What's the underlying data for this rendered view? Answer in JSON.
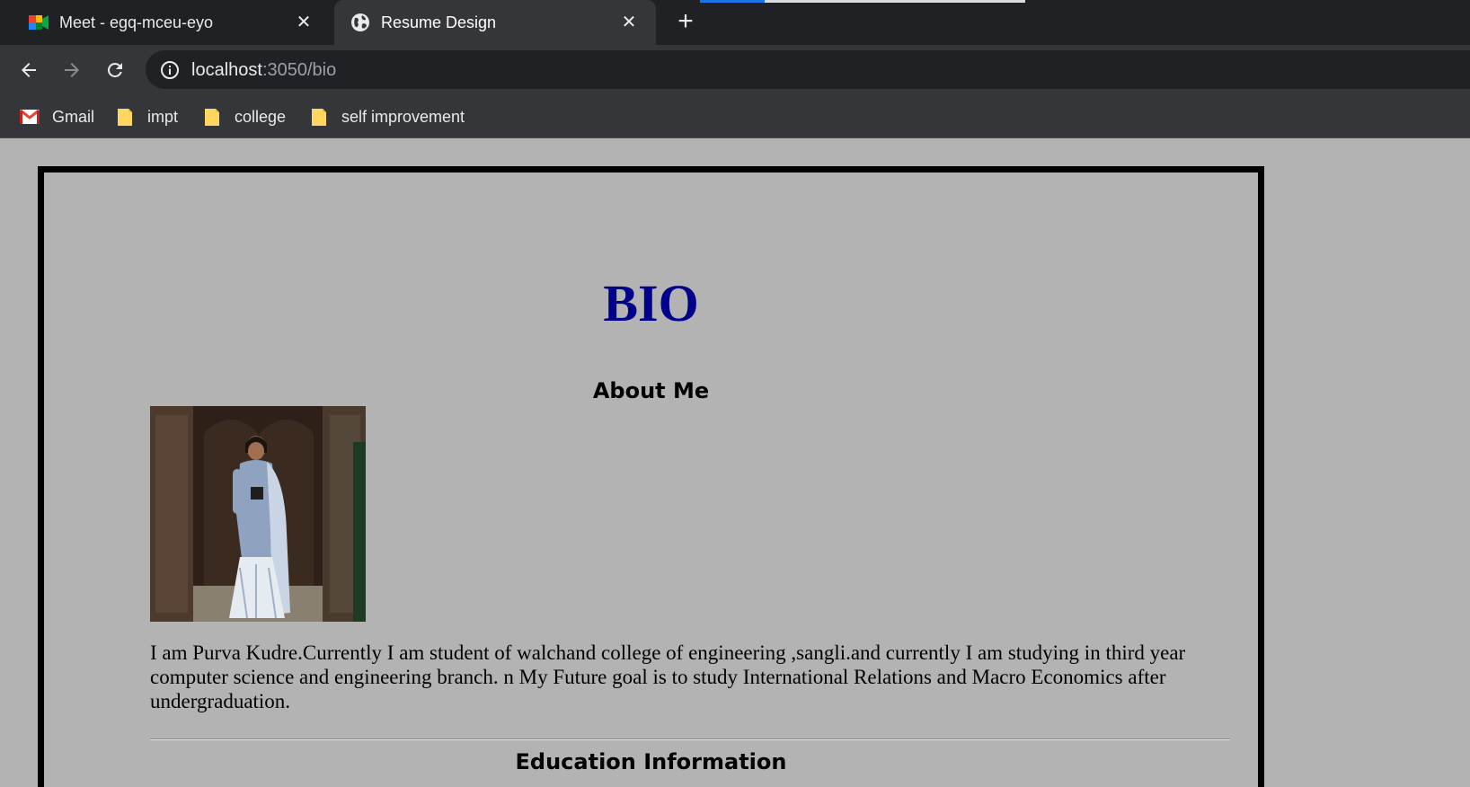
{
  "browser": {
    "tabs": [
      {
        "title": "Meet - egq-mceu-eyo",
        "icon": "google-meet-icon",
        "active": false
      },
      {
        "title": "Resume Design",
        "icon": "globe-icon",
        "active": true
      }
    ],
    "new_tab_symbol": "+",
    "close_symbol": "✕",
    "url": {
      "host": "localhost",
      "path": ":3050/bio"
    },
    "bookmarks": [
      {
        "label": "Gmail",
        "icon": "gmail-icon"
      },
      {
        "label": "impt",
        "icon": "folder-icon"
      },
      {
        "label": "college",
        "icon": "folder-icon"
      },
      {
        "label": "self improvement",
        "icon": "folder-icon"
      }
    ],
    "colors": {
      "tabbar": "#202124",
      "toolbar": "#35363a",
      "accent": "#1a73e8"
    }
  },
  "page": {
    "title": "BIO",
    "about_heading": "About Me",
    "photo": {
      "icon": "profile-photo"
    },
    "bio_text": "I am Purva Kudre.Currently I am student of walchand college of engineering ,sangli.and currently I am studying in third year computer science and engineering branch. n My Future goal is to study International Relations and Macro Economics after undergraduation.",
    "education_heading": "Education Information",
    "colors": {
      "background": "#b3b3b3",
      "title": "#00008b",
      "border": "#000000"
    }
  }
}
